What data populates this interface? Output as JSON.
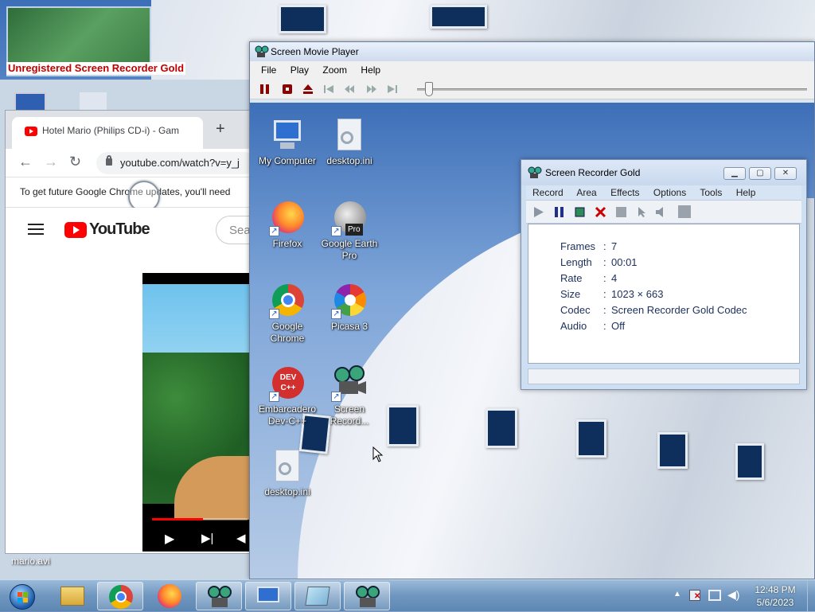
{
  "chrome": {
    "tab_title": "Hotel Mario (Philips CD-i) - Gam",
    "new_tab": "+",
    "url": "youtube.com/watch?v=y_j",
    "infobar": "To get future Google Chrome updates, you'll need",
    "youtube_wordmark": "YouTube",
    "search_placeholder": "Sea",
    "video_progress": 0.53
  },
  "desktop_back": {
    "mario_label": "mario.avi"
  },
  "player": {
    "title": "Screen Movie Player",
    "menu": [
      "File",
      "Play",
      "Zoom",
      "Help"
    ],
    "watermark": "Unregistered Screen Recorder Gold",
    "slider_position": 0.02
  },
  "desktop_icons": [
    {
      "label": "My Computer",
      "icon": "my-computer-icon"
    },
    {
      "label": "desktop.ini",
      "icon": "ini-file-icon"
    },
    {
      "label": "Firefox",
      "icon": "firefox-icon"
    },
    {
      "label": "Google Earth Pro",
      "icon": "google-earth-icon"
    },
    {
      "label": "Google Chrome",
      "icon": "chrome-icon"
    },
    {
      "label": "Picasa 3",
      "icon": "picasa-icon"
    },
    {
      "label": "Embarcadero Dev-C++",
      "icon": "devcpp-icon"
    },
    {
      "label": "Screen Record...",
      "icon": "screen-recorder-icon"
    },
    {
      "label": "desktop.ini",
      "icon": "ini-file-icon"
    }
  ],
  "devcpp_badge": "DEV C++",
  "earth_badge": "Pro",
  "recorder": {
    "title": "Screen Recorder Gold",
    "menu": [
      "Record",
      "Area",
      "Effects",
      "Options",
      "Tools",
      "Help"
    ],
    "props": [
      {
        "key": "Frames",
        "value": "7"
      },
      {
        "key": "Length",
        "value": "00:01"
      },
      {
        "key": "Rate",
        "value": "4"
      },
      {
        "key": "Size",
        "value": "1023 × 663"
      },
      {
        "key": "Codec",
        "value": "Screen Recorder Gold Codec"
      },
      {
        "key": "Audio",
        "value": "Off"
      }
    ],
    "separator": ":"
  },
  "taskbar": {
    "time": "12:48 PM",
    "date": "5/6/2023",
    "buttons": [
      "start-orb",
      "file-explorer",
      "chrome",
      "firefox",
      "screen-recorder",
      "my-computer",
      "screen-player",
      "screen-recorder-gold"
    ]
  },
  "colors": {
    "watermark_red": "#c00000",
    "prop_text": "#1c2f5c",
    "youtube_red": "#ff0000"
  }
}
